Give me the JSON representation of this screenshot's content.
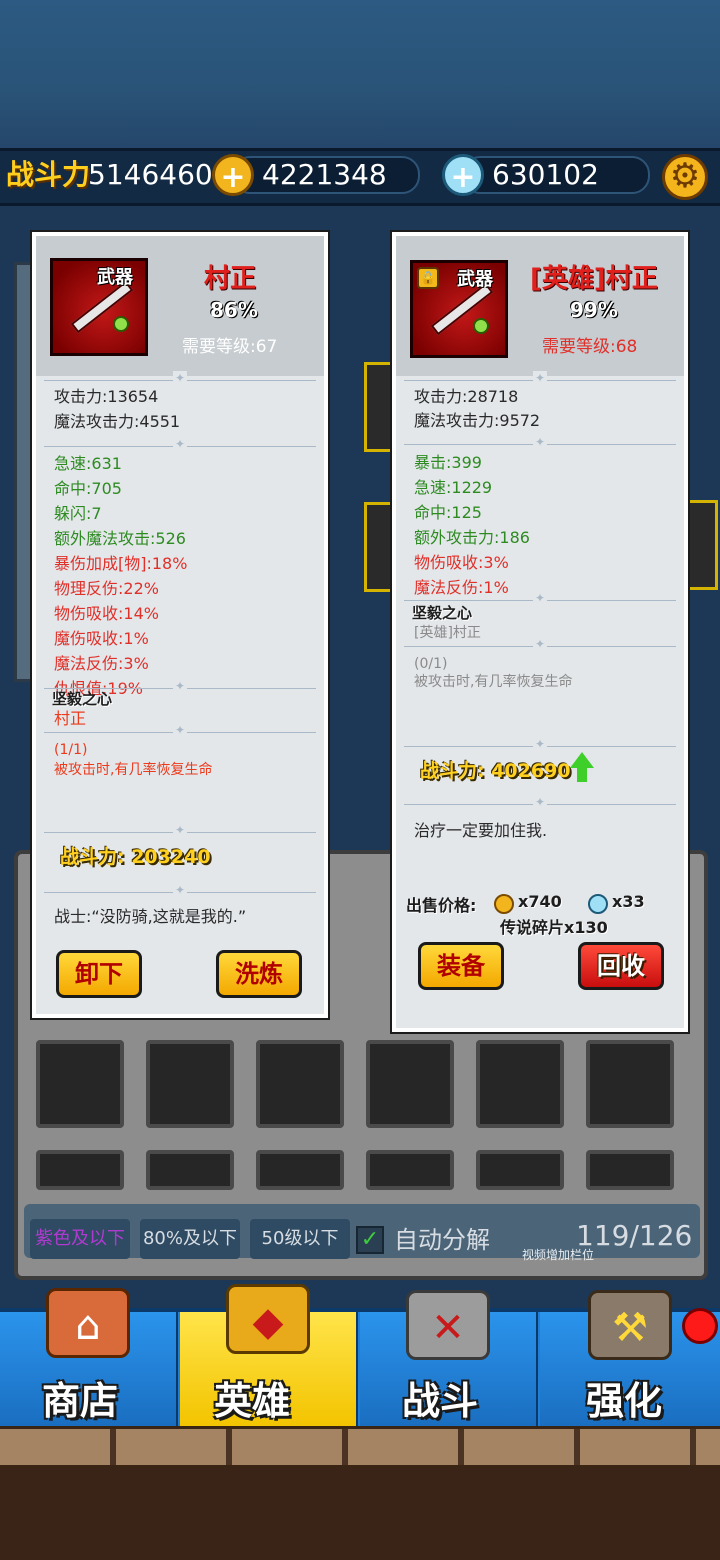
{
  "topbar": {
    "power_label": "战斗力",
    "power_value": "5146460",
    "gold_value": "4221348",
    "gem_value": "630102"
  },
  "equipped_card": {
    "slot_tag": "武器",
    "name": "村正",
    "percent": "86%",
    "required_level": "需要等级:67",
    "base_stats": [
      "攻击力:13654",
      "魔法攻击力:4551"
    ],
    "bonus_stats_green": [
      "急速:631",
      "命中:705",
      "躲闪:7",
      "额外魔法攻击:526"
    ],
    "bonus_stats_red": [
      "暴伤加成[物]:18%",
      "物理反伤:22%",
      "物伤吸收:14%",
      "魔伤吸收:1%",
      "魔法反伤:3%",
      "仇恨值:19%"
    ],
    "set_title": "坚毅之心",
    "set_member": "村正",
    "set_count": "(1/1)",
    "set_effect": "被攻击时,有几率恢复生命",
    "combat_power": "战斗力: 203240",
    "flavor_text": "战士:“没防骑,这就是我的.”",
    "btn_unequip": "卸下",
    "btn_reforge": "洗炼"
  },
  "new_card": {
    "slot_tag": "武器",
    "name": "[英雄]村正",
    "percent": "99%",
    "required_level": "需要等级:68",
    "base_stats": [
      "攻击力:28718",
      "魔法攻击力:9572"
    ],
    "bonus_stats_green": [
      "暴击:399",
      "急速:1229",
      "命中:125",
      "额外攻击力:186"
    ],
    "bonus_stats_red": [
      "物伤吸收:3%",
      "魔法反伤:1%"
    ],
    "set_title": "坚毅之心",
    "set_member": "[英雄]村正",
    "set_count": "(0/1)",
    "set_effect": "被攻击时,有几率恢复生命",
    "combat_power": "战斗力: 402690",
    "flavor_text": "治疗一定要加住我.",
    "sell_label": "出售价格:",
    "sell_gold": "x740",
    "sell_gem": "x33",
    "sell_shard": "传说碎片x130",
    "btn_equip": "装备",
    "btn_recycle": "回收"
  },
  "inventory": {
    "filter_purple": "紫色及以下",
    "filter_percent": "80%及以下",
    "filter_level": "50级以下",
    "auto_decompose": "自动分解",
    "capacity": "119/126",
    "capacity_note": "视频增加栏位"
  },
  "nav": {
    "shop": "商店",
    "hero": "英雄",
    "battle": "战斗",
    "enhance": "强化"
  },
  "colors": {
    "accent_gold": "#ffcf1e",
    "item_red": "#e0201c",
    "stat_green": "#2e8b22",
    "stat_red": "#e0302a",
    "nav_blue": "#1f7fd8",
    "nav_active": "#f3c400"
  }
}
